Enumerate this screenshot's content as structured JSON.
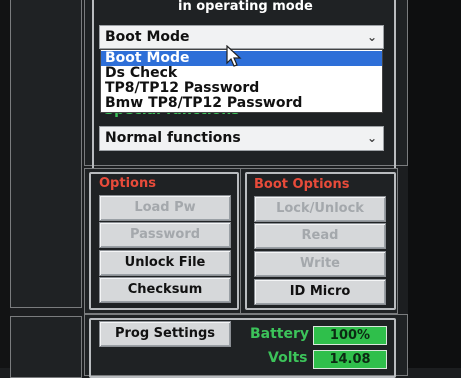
{
  "header": {
    "title": "in operating mode"
  },
  "mode_select": {
    "value": "Boot Mode",
    "options": [
      "Boot Mode",
      "Ds Check",
      "TP8/TP12 Password",
      "Bmw TP8/TP12 Password"
    ]
  },
  "special_functions": {
    "label": "Special functions",
    "value": "Normal functions"
  },
  "options_panel": {
    "label": "Options",
    "buttons": [
      {
        "label": "Load Pw",
        "enabled": false
      },
      {
        "label": "Password",
        "enabled": false
      },
      {
        "label": "Unlock File",
        "enabled": true
      },
      {
        "label": "Checksum",
        "enabled": true
      }
    ]
  },
  "boot_options_panel": {
    "label": "Boot Options",
    "buttons": [
      {
        "label": "Lock/Unlock",
        "enabled": false
      },
      {
        "label": "Read",
        "enabled": false
      },
      {
        "label": "Write",
        "enabled": false
      },
      {
        "label": "ID Micro",
        "enabled": true
      }
    ]
  },
  "bottom": {
    "prog_settings_label": "Prog Settings",
    "battery_label": "Battery",
    "battery_value": "100%",
    "volts_label": "Volts",
    "volts_value": "14.08"
  },
  "colors": {
    "red_label": "#e84b3a",
    "green_label": "#3cc35a",
    "highlight": "#2e6fd8",
    "value_box": "#2fbf4b"
  }
}
